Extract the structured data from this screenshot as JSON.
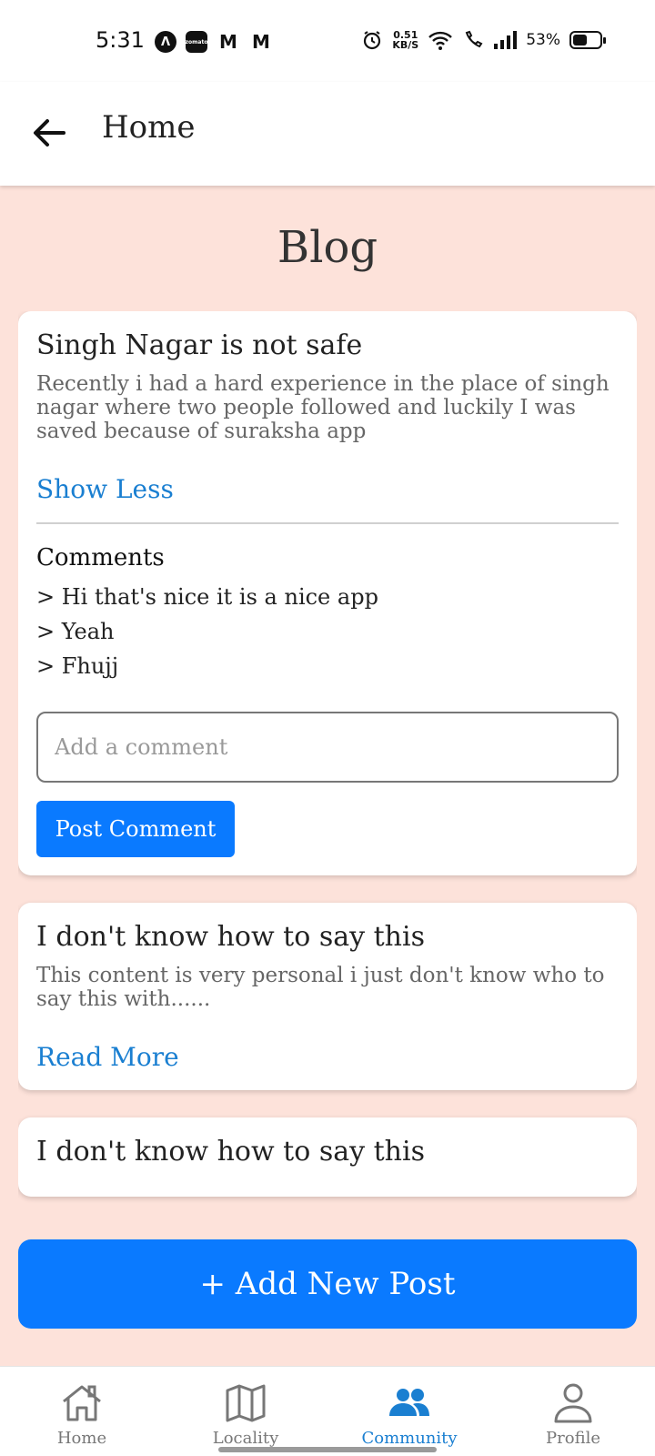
{
  "status_bar": {
    "time": "5:31",
    "left_icons": [
      {
        "icon": "navigation-app-icon",
        "glyph": "Λ"
      },
      {
        "icon": "zomato-app-icon",
        "glyph": "zomato"
      },
      {
        "icon": "m-app-icon",
        "glyph": "M"
      },
      {
        "icon": "gmail-icon",
        "glyph": "M"
      }
    ],
    "net_speed_value": "0.51",
    "net_speed_unit": "KB/S",
    "battery_percent": "53%",
    "battery_level": 0.53
  },
  "app_bar": {
    "back_icon": "arrow-left-icon",
    "title": "Home"
  },
  "page": {
    "title": "Blog",
    "background": "#fde2da",
    "accent": "#0a7aff",
    "link_color": "#1a7fd1"
  },
  "posts": [
    {
      "title": "Singh Nagar is not safe",
      "body": "Recently i had a hard experience in the place of singh nagar where two people followed and luckily I was saved because of suraksha app",
      "toggle_label": "Show Less",
      "comments_heading": "Comments",
      "comments": [
        "> Hi that's nice it is a nice app",
        "> Yeah",
        "> Fhujj"
      ],
      "comment_placeholder": "Add a comment",
      "comment_value": "",
      "post_comment_label": "Post Comment"
    },
    {
      "title": "I don't know how to say this",
      "body": "This content is very personal i just don't know who to say this with......",
      "toggle_label": "Read More"
    },
    {
      "title": "I don't know how to say this"
    }
  ],
  "add_post_label": "+ Add New Post",
  "bottom_nav": [
    {
      "label": "Home",
      "icon": "home-icon",
      "active": false
    },
    {
      "label": "Locality",
      "icon": "map-icon",
      "active": false
    },
    {
      "label": "Community",
      "icon": "community-icon",
      "active": true
    },
    {
      "label": "Profile",
      "icon": "profile-icon",
      "active": false
    }
  ]
}
